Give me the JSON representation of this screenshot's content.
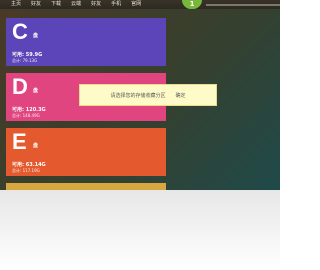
{
  "menubar": {
    "items": [
      "主页",
      "好友",
      "下载",
      "云端",
      "好友",
      "手机",
      "官网"
    ],
    "badge": "1"
  },
  "disks": [
    {
      "letter": "C",
      "suffix": "盘",
      "available": "可用: 59.9G",
      "total": "总计: 79.13G",
      "color": "#5b45b8"
    },
    {
      "letter": "D",
      "suffix": "盘",
      "available": "可用: 120.3G",
      "total": "总计: 148.49G",
      "color": "#e0457f"
    },
    {
      "letter": "E",
      "suffix": "盘",
      "available": "可用: 63.14G",
      "total": "总计: 117.19G",
      "color": "#e45a2e"
    }
  ],
  "toast": {
    "message": "请选择您的存储收藏分区",
    "confirm": "确定"
  },
  "colors": {
    "bottom_strip": "#d8a840",
    "toast_background": "#fffbc8",
    "badge": "#78b73a"
  }
}
